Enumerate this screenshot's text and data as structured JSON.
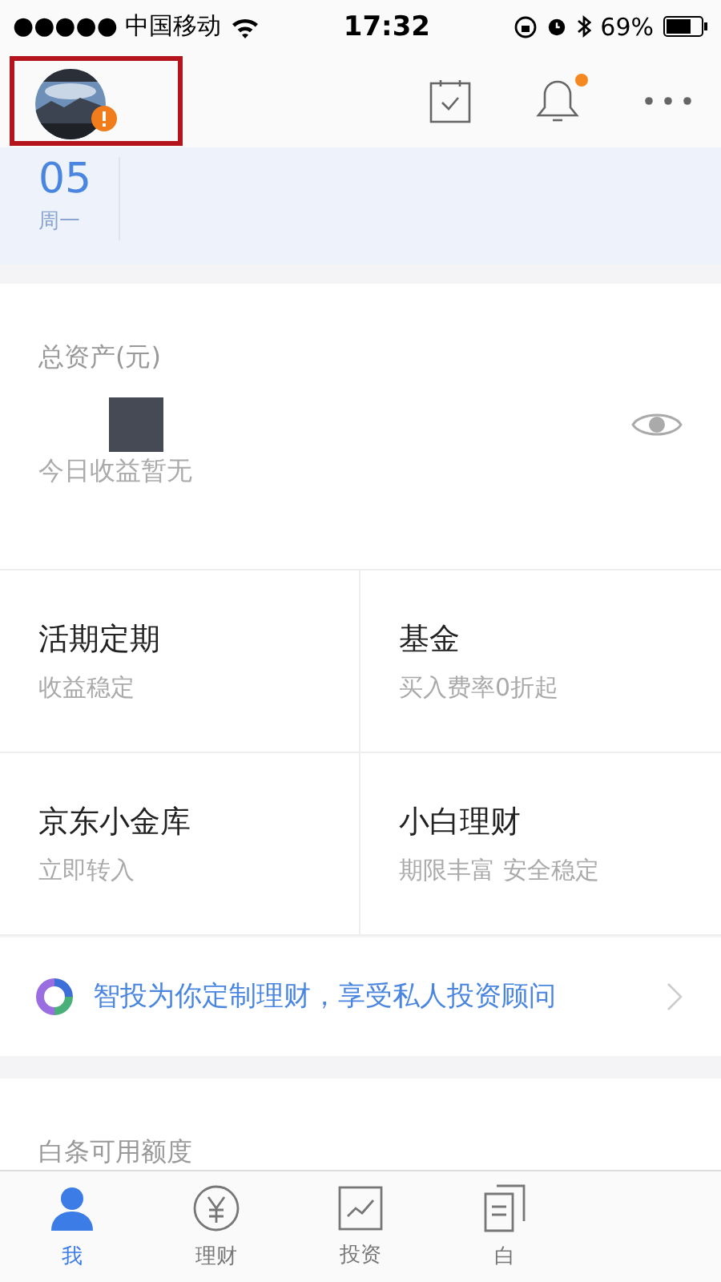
{
  "status_bar": {
    "carrier": "●●●●● 中国移动",
    "time": "17:32",
    "battery": "69%"
  },
  "header": {
    "avatar_alert": true,
    "notification_dot": true
  },
  "date": {
    "day": "05",
    "weekday": "周一"
  },
  "assets": {
    "label": "总资产(元)",
    "today": "今日收益暂无"
  },
  "products": [
    {
      "title": "活期定期",
      "subtitle": "收益稳定"
    },
    {
      "title": "基金",
      "subtitle": "买入费率0折起"
    },
    {
      "title": "京东小金库",
      "subtitle": "立即转入"
    },
    {
      "title": "小白理财",
      "subtitle": "期限丰富 安全稳定"
    }
  ],
  "promo": {
    "text": "智投为你定制理财，享受私人投资顾问"
  },
  "credit": {
    "label": "白条可用额度"
  },
  "tabs": [
    {
      "label": "我",
      "kind": "person",
      "selected": true
    },
    {
      "label": "理财",
      "kind": "yen",
      "selected": false
    },
    {
      "label": "投资",
      "kind": "chart",
      "selected": false
    },
    {
      "label": "白",
      "kind": "doc",
      "selected": false
    }
  ]
}
